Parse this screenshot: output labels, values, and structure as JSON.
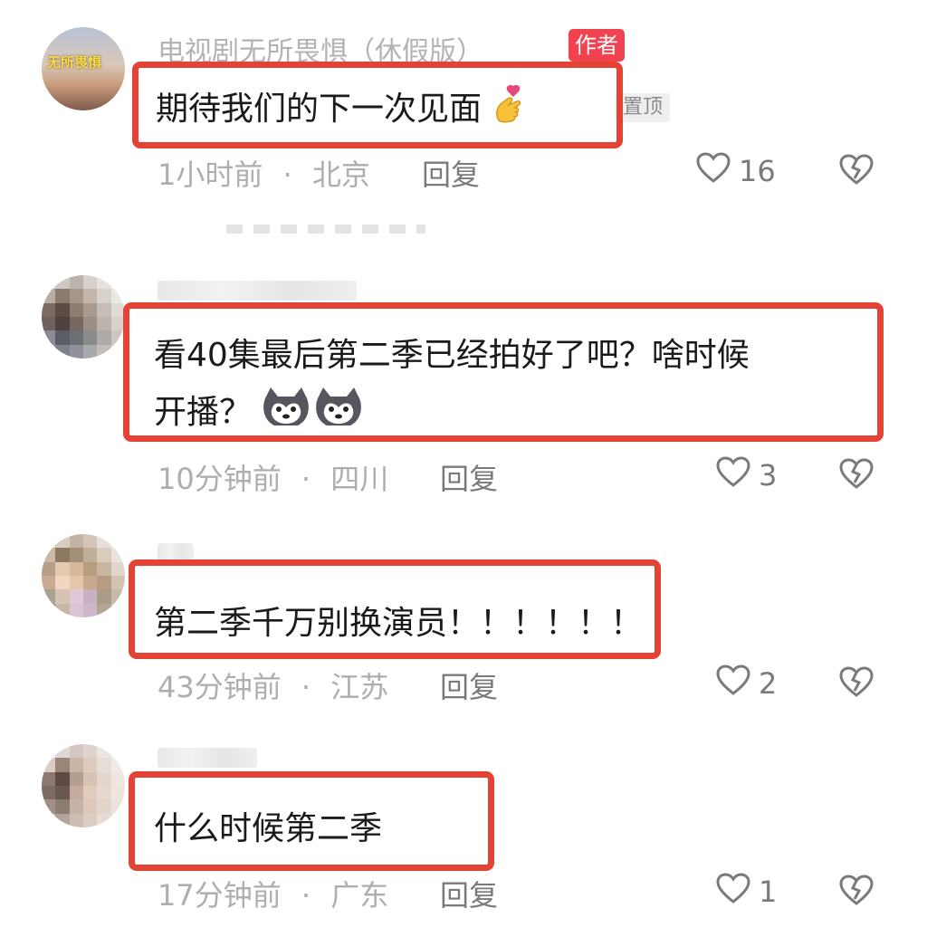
{
  "comments": [
    {
      "username": "电视剧无所畏惧（休假版）",
      "badge": "作者",
      "pin": "置顶",
      "avatar_text": "无所畏惧",
      "text": "期待我们的下一次见面",
      "emoji": "finger-heart-emoji",
      "time": "1小时前",
      "location": "北京",
      "reply": "回复",
      "likes": "16"
    },
    {
      "text_line1": "看40集最后第二季已经拍好了吧？啥时候",
      "text_line2": "开播？",
      "emoji": "husky-dog-emoji",
      "time": "10分钟前",
      "location": "四川",
      "reply": "回复",
      "likes": "3"
    },
    {
      "text": "第二季千万别换演员！！！！",
      "text_tail": "！！",
      "time": "43分钟前",
      "location": "江苏",
      "reply": "回复",
      "likes": "2"
    },
    {
      "text": "什么时候第二季",
      "time": "17分钟前",
      "location": "广东",
      "reply": "回复",
      "likes": "1"
    }
  ],
  "separator": "·",
  "colors": {
    "highlight": "#e34234",
    "badge": "#f1434f",
    "meta": "#aeaeae"
  }
}
